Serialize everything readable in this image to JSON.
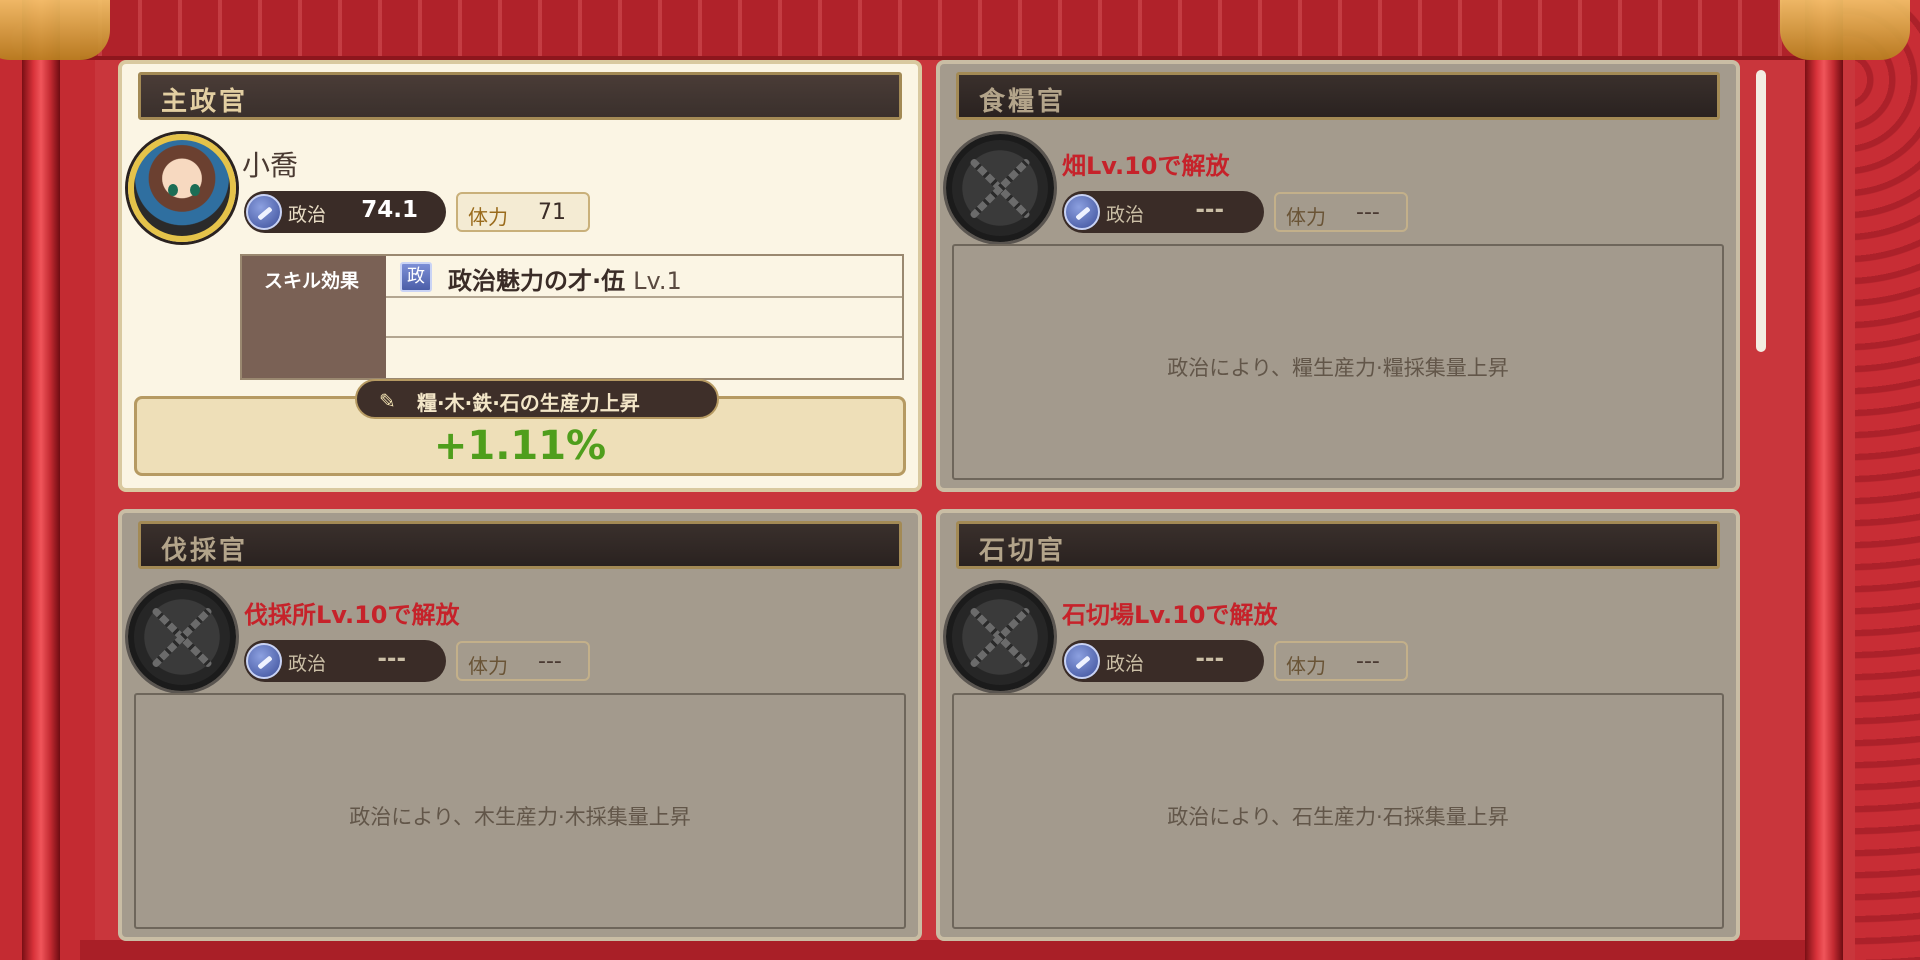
{
  "panels": {
    "chief": {
      "title": "主政官",
      "name": "小喬",
      "politics_label": "政治",
      "politics_value": "74.1",
      "stamina_label": "体力",
      "stamina_value": "71",
      "skill_header": "スキル効果",
      "skill_badge": "政",
      "skill_name": "政治魅力の才·伍",
      "skill_level": "Lv.1",
      "production_label": "糧·木·鉄·石の生産力上昇",
      "production_value": "+1.11%"
    },
    "food": {
      "title": "食糧官",
      "unlock": "畑Lv.10で解放",
      "politics_label": "政治",
      "politics_value": "---",
      "stamina_label": "体力",
      "stamina_value": "---",
      "description": "政治により、糧生産力·糧採集量上昇"
    },
    "lumber": {
      "title": "伐採官",
      "unlock": "伐採所Lv.10で解放",
      "politics_label": "政治",
      "politics_value": "---",
      "stamina_label": "体力",
      "stamina_value": "---",
      "description": "政治により、木生産力·木採集量上昇"
    },
    "stone": {
      "title": "石切官",
      "unlock": "石切場Lv.10で解放",
      "politics_label": "政治",
      "politics_value": "---",
      "stamina_label": "体力",
      "stamina_value": "---",
      "description": "政治により、石生産力·石採集量上昇"
    }
  },
  "colors": {
    "background_red": "#c9363c",
    "active_panel": "#fbf5e4",
    "locked_panel": "#a49b8d",
    "unlock_text": "#c6222a",
    "production_value": "#4f9e1c"
  },
  "icons": [
    "politics-brush-icon",
    "chain-lock-icon",
    "skill-politics-icon"
  ]
}
